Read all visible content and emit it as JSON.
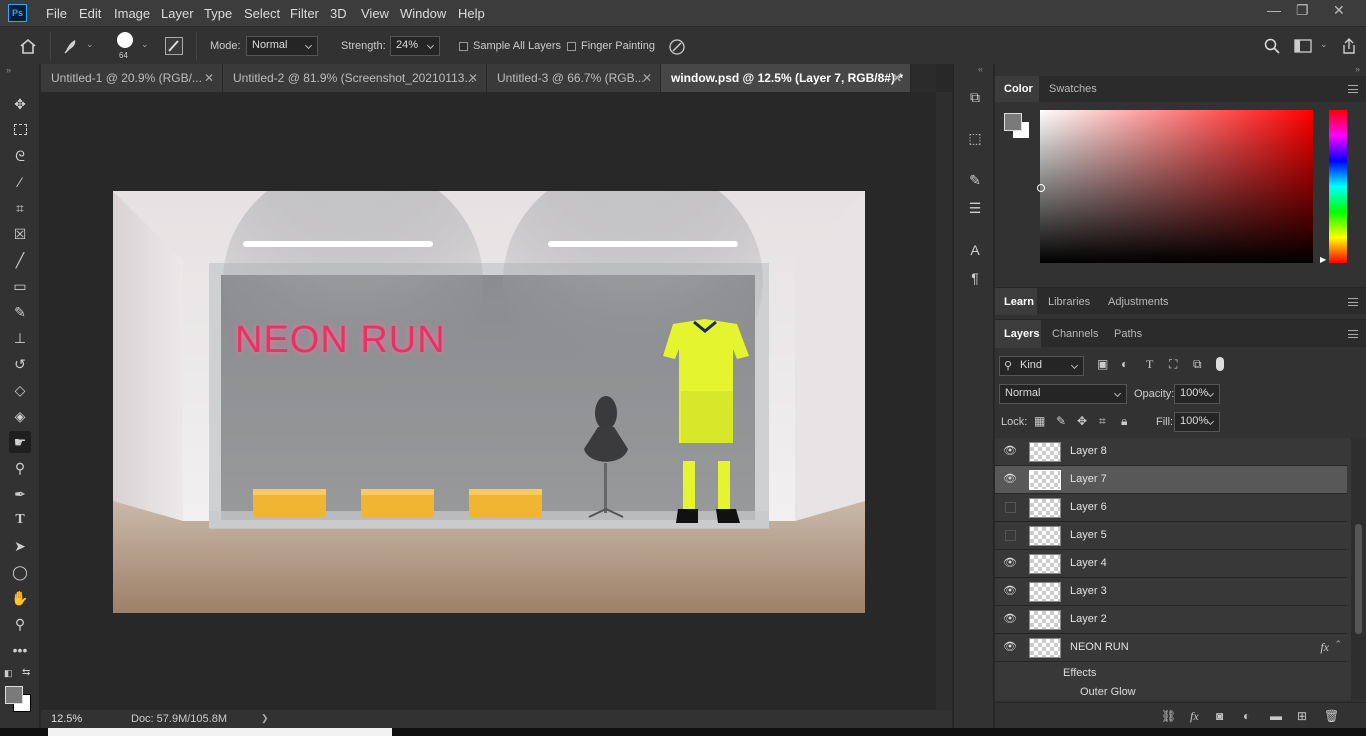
{
  "app": {
    "logo": "Ps"
  },
  "menu": {
    "items": [
      "File",
      "Edit",
      "Image",
      "Layer",
      "Type",
      "Select",
      "Filter",
      "3D",
      "View",
      "Window",
      "Help"
    ]
  },
  "window_controls": {
    "minimize": "—",
    "restore": "❐",
    "close": "✕"
  },
  "options": {
    "brush_size": "64",
    "mode_label": "Mode:",
    "mode_value": "Normal",
    "strength_label": "Strength:",
    "strength_value": "24%",
    "sample_all_layers": "Sample All Layers",
    "finger_painting": "Finger Painting"
  },
  "tabs": [
    {
      "label": "Untitled-1 @ 20.9% (RGB/..."
    },
    {
      "label": "Untitled-2 @ 81.9% (Screenshot_20210113..."
    },
    {
      "label": "Untitled-3 @ 66.7% (RGB..."
    },
    {
      "label": "window.psd @ 12.5% (Layer 7, RGB/8#) *"
    }
  ],
  "tab_close": "✕",
  "canvas": {
    "neon_text": "NEON RUN"
  },
  "status": {
    "zoom": "12.5%",
    "doc": "Doc: 57.9M/105.8M",
    "arrow": "❯"
  },
  "color_panel": {
    "tabs": [
      "Color",
      "Swatches"
    ],
    "accent": "#ff0000"
  },
  "learn_panel": {
    "tabs": [
      "Learn",
      "Libraries",
      "Adjustments"
    ]
  },
  "layers_panel": {
    "tabs": [
      "Layers",
      "Channels",
      "Paths"
    ],
    "filter_kind": "Kind",
    "blend_mode": "Normal",
    "opacity_label": "Opacity:",
    "opacity_value": "100%",
    "lock_label": "Lock:",
    "fill_label": "Fill:",
    "fill_value": "100%",
    "layers": [
      {
        "name": "Layer 8",
        "visible": true
      },
      {
        "name": "Layer 7",
        "visible": true,
        "selected": true
      },
      {
        "name": "Layer 6",
        "visible": false
      },
      {
        "name": "Layer 5",
        "visible": false
      },
      {
        "name": "Layer 4",
        "visible": true
      },
      {
        "name": "Layer 3",
        "visible": true
      },
      {
        "name": "Layer 2",
        "visible": true
      },
      {
        "name": "NEON RUN",
        "visible": true,
        "fx": "fx"
      }
    ],
    "effects_label": "Effects",
    "outer_glow_label": "Outer Glow"
  }
}
